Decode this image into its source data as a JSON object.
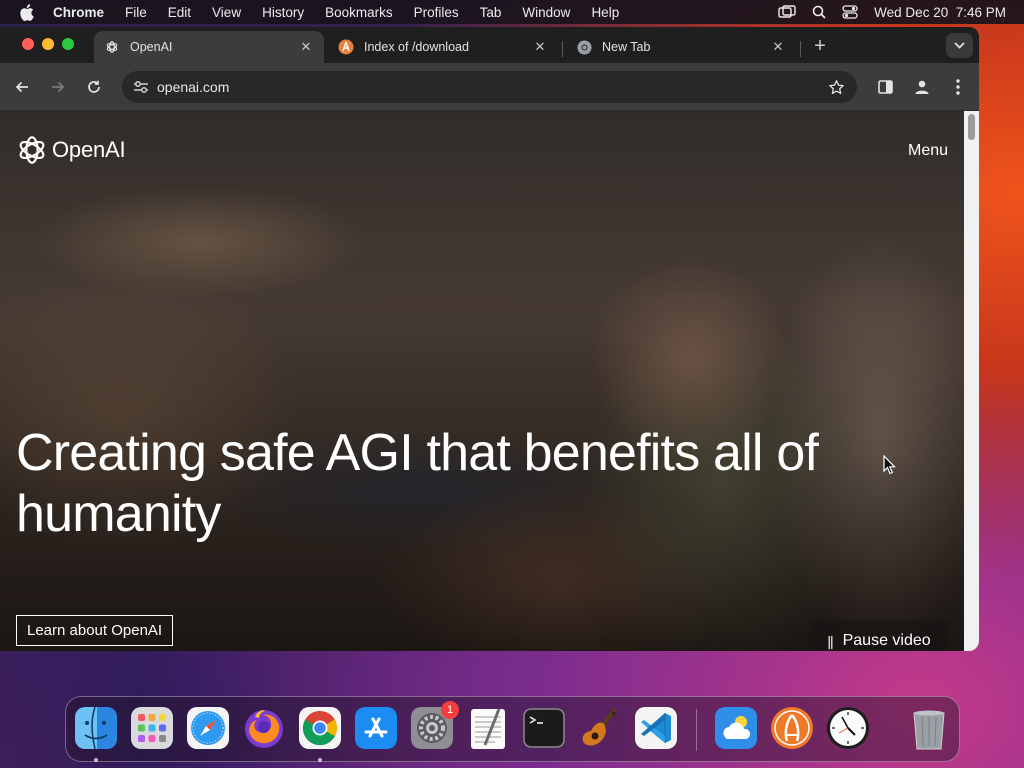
{
  "menubar": {
    "apple_icon": "apple-logo-icon",
    "app_name": "Chrome",
    "items": [
      "File",
      "Edit",
      "View",
      "History",
      "Bookmarks",
      "Profiles",
      "Tab",
      "Window",
      "Help"
    ],
    "datetime": "Wed Dec 20  7:46 PM"
  },
  "tabs": [
    {
      "title": "OpenAI",
      "icon": "openai-favicon",
      "active": true
    },
    {
      "title": "Index of /download",
      "icon": "download-site-favicon",
      "active": false
    },
    {
      "title": "New Tab",
      "icon": "chrome-favicon",
      "active": false
    }
  ],
  "toolbar": {
    "url": "openai.com"
  },
  "page": {
    "logo_text": "OpenAI",
    "menu_label": "Menu",
    "headline": "Creating safe AGI that benefits all of humanity",
    "cta_label": "Learn about OpenAI",
    "pause_label": "Pause video",
    "pause_icon": "||"
  },
  "dock": {
    "apps": [
      "Finder",
      "Launchpad",
      "Safari",
      "Firefox",
      "Chrome",
      "App Store",
      "System Settings",
      "TextEdit",
      "Terminal",
      "GarageBand",
      "Visual Studio Code",
      "Weather",
      "Anaconda",
      "Clock",
      "Trash"
    ],
    "settings_badge": "1"
  }
}
